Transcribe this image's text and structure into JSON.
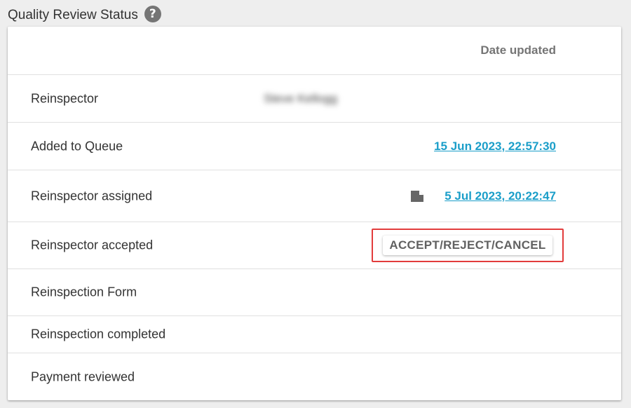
{
  "header": {
    "title": "Quality Review Status",
    "help_icon": "help-circle-icon",
    "help_glyph": "?"
  },
  "table": {
    "column_header": "Date updated",
    "rows": [
      {
        "label": "Reinspector",
        "value": "Steve Kellogg"
      },
      {
        "label": "Added to Queue",
        "date": "15 Jun 2023, 22:57:30"
      },
      {
        "label": "Reinspector assigned",
        "date": "5 Jul 2023, 20:22:47",
        "icon": "file-icon"
      },
      {
        "label": "Reinspector accepted",
        "button": "ACCEPT/REJECT/CANCEL"
      },
      {
        "label": "Reinspection Form"
      },
      {
        "label": "Reinspection completed"
      },
      {
        "label": "Payment reviewed"
      }
    ]
  },
  "colors": {
    "link": "#1a9ec9",
    "highlight": "#e23c3c",
    "header_text": "#757575"
  }
}
